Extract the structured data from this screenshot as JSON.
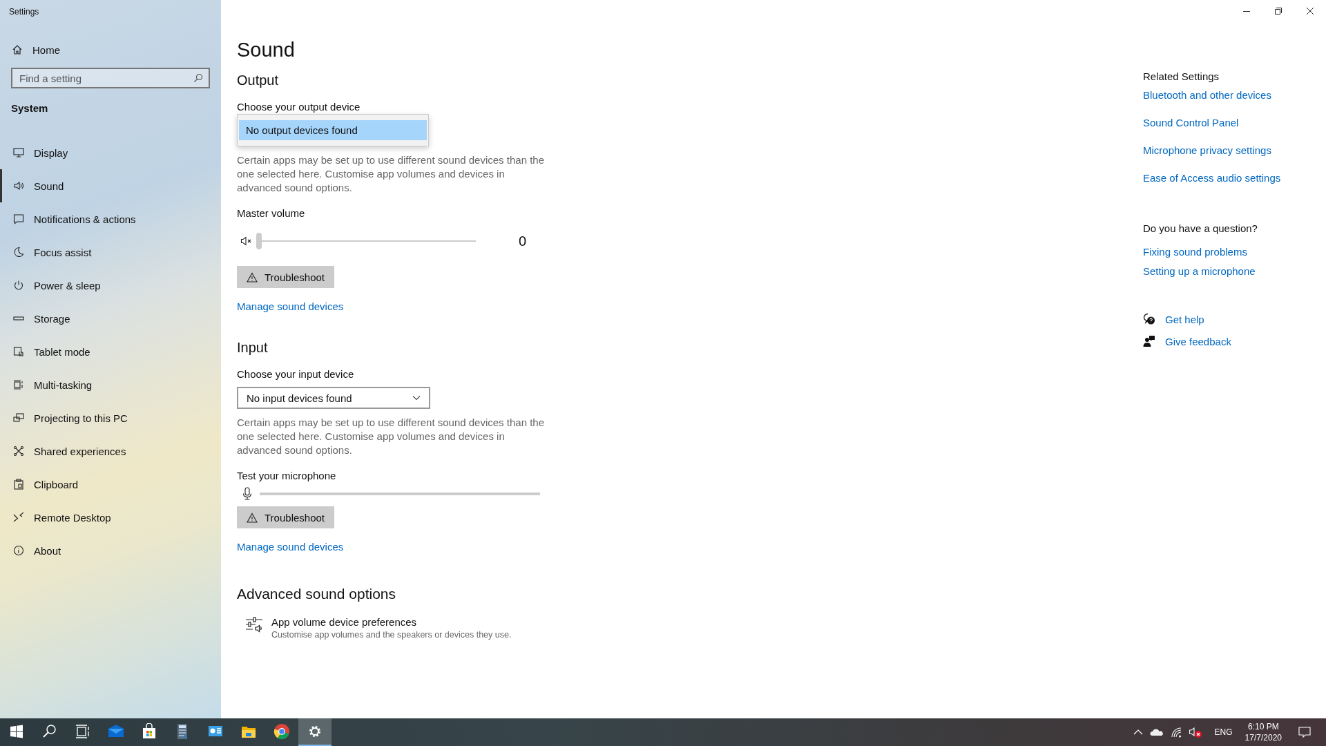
{
  "window": {
    "title": "Settings"
  },
  "sidebar": {
    "home": "Home",
    "search": {
      "placeholder": "Find a setting"
    },
    "section": "System",
    "items": [
      {
        "label": "Display",
        "kind": "display",
        "selected": false
      },
      {
        "label": "Sound",
        "kind": "sound",
        "selected": true
      },
      {
        "label": "Notifications & actions",
        "kind": "notifications",
        "selected": false
      },
      {
        "label": "Focus assist",
        "kind": "focus",
        "selected": false
      },
      {
        "label": "Power & sleep",
        "kind": "power",
        "selected": false
      },
      {
        "label": "Storage",
        "kind": "storage",
        "selected": false
      },
      {
        "label": "Tablet mode",
        "kind": "tablet",
        "selected": false
      },
      {
        "label": "Multi-tasking",
        "kind": "multitasking",
        "selected": false
      },
      {
        "label": "Projecting to this PC",
        "kind": "projecting",
        "selected": false
      },
      {
        "label": "Shared experiences",
        "kind": "shared",
        "selected": false
      },
      {
        "label": "Clipboard",
        "kind": "clipboard",
        "selected": false
      },
      {
        "label": "Remote Desktop",
        "kind": "remote",
        "selected": false
      },
      {
        "label": "About",
        "kind": "about",
        "selected": false
      }
    ]
  },
  "page": {
    "title": "Sound",
    "output": {
      "heading": "Output",
      "device_label": "Choose your output device",
      "dropdown": {
        "expanded": true,
        "options": [
          {
            "label": "No output devices found",
            "selected": true
          }
        ]
      },
      "description": "Certain apps may be set up to use different sound devices than the one selected here. Customise app volumes and devices in advanced sound options.",
      "volume": {
        "label": "Master volume",
        "muted": true,
        "level": 0,
        "reading": "0"
      },
      "troubleshoot": "Troubleshoot",
      "manage_link": "Manage sound devices"
    },
    "input": {
      "heading": "Input",
      "device_label": "Choose your input device",
      "dropdown": {
        "expanded": false,
        "value": "No input devices found"
      },
      "description": "Certain apps may be set up to use different sound devices than the one selected here. Customise app volumes and devices in advanced sound options.",
      "microphone": {
        "label": "Test your microphone",
        "level": 0
      },
      "troubleshoot": "Troubleshoot",
      "manage_link": "Manage sound devices"
    },
    "advanced": {
      "heading": "Advanced sound options",
      "item": {
        "title": "App volume  device preferences",
        "subtitle": "Customise app volumes and the speakers or devices they use."
      }
    }
  },
  "related": {
    "heading": "Related Settings",
    "links": [
      "Bluetooth and other devices",
      "Sound Control Panel",
      "Microphone privacy settings",
      "Ease of Access audio settings"
    ],
    "question": {
      "heading": "Do you have a question?",
      "links": [
        "Fixing sound problems",
        "Setting up a microphone"
      ]
    },
    "actions": [
      {
        "label": "Get help",
        "kind": "help"
      },
      {
        "label": "Give feedback",
        "kind": "feedback"
      }
    ]
  },
  "taskbar": {
    "apps": [
      {
        "kind": "start",
        "active": false
      },
      {
        "kind": "search",
        "active": false
      },
      {
        "kind": "taskview",
        "active": false
      },
      {
        "kind": "mail",
        "active": false
      },
      {
        "kind": "store",
        "active": false
      },
      {
        "kind": "calculator",
        "active": false
      },
      {
        "kind": "panel",
        "active": false
      },
      {
        "kind": "folder",
        "active": false
      },
      {
        "kind": "browser",
        "active": false
      },
      {
        "kind": "settings",
        "active": true
      }
    ],
    "tray": {
      "sound_muted": true,
      "language": "ENG",
      "time": "6:10 PM",
      "date": "17/7/2020"
    }
  }
}
